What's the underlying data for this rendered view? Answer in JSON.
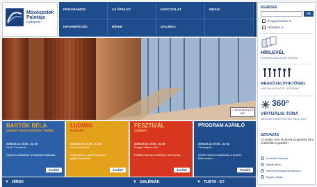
{
  "logo": {
    "line1": "Művészetek",
    "line2": "Palotája",
    "line3": "budapest"
  },
  "nav": [
    {
      "label": "PROGRAMOK"
    },
    {
      "label": "AZ ÉPÜLET"
    },
    {
      "label": "KAPCSOLAT"
    },
    {
      "label": "MÉDIA"
    },
    {
      "label": "INFORMÁCIÓK"
    },
    {
      "label": "HÍREK"
    },
    {
      "label": "GALÉRIA"
    },
    {
      "label": ""
    }
  ],
  "search": {
    "title": "KERESÉS",
    "placeholder": "",
    "ok_label": "OK",
    "checkbox1": "Programokban is",
    "checkbox2": "Hírekben is"
  },
  "sidebar": {
    "newsletter_title": "HÍRLEVÉL",
    "newsletter_sub": "FELIRATKOZÁS A HÍRLEVÉLRE",
    "access_title": "MEGKÖZELÍTHETŐSÉG",
    "access_sub": "HOGYAN JUTHAT EL HOZZÁNK?",
    "tour_title_a": "360°",
    "tour_title_b": "VIRTUÁLIS TÚRA",
    "tour_sub": "JÁRJA BE A MŰVÉSZETEK PALOTÁJÁT"
  },
  "poll": {
    "title": "SZAVAZÁS",
    "question": "Az épület mely részének programjai iránt érdeklődik leginkább?",
    "options": [
      "Fesztivál Színház",
      "Bartók Béla",
      "Nemzeti Hangversenyterem",
      "Egyéb helyek"
    ]
  },
  "hero": {
    "zoom_label": "NÖVESZTHETŐ KÉP"
  },
  "cards": [
    {
      "title": "BARTÓK BÉLA",
      "subtitle": "NEMZETI HANGVERSENYTEREM",
      "date": "2006.09.16 19:00 - 22:30",
      "event": "Verdi: Trovatore",
      "text": "Opera a palotában ünnepélyes előadás...",
      "more": "Tovább",
      "color": "#2b5fa8"
    },
    {
      "title": "LUDWIG",
      "subtitle": "MÚZEUM",
      "date": "2006.09.09 10:00 - 22:30",
      "event": "Fesztivál nézeti",
      "text": "Válogatás a Ludwig Múzeum gyűjteményéből...",
      "more": "Tovább",
      "color": "#e4a21a"
    },
    {
      "title": "FESZTIVÁL",
      "subtitle": "SZÍNHÁZ",
      "date": "2006.09.16 19:00 - 22:00",
      "event": "Magyar Állami népi...",
      "text": "Példák népi tánc estekből, ünnepi bál...",
      "more": "Tovább",
      "color": "#d8361f"
    },
    {
      "title": "PROGRAM AJÁNLÓ",
      "subtitle": "",
      "date": "2006.09.21 20:00 - 22:02",
      "event": "Táncképek",
      "text": "Zenés, táncos varázsolás a Bohém Éttermeben...",
      "more": "Tovább",
      "color": "#1f4d8c"
    }
  ],
  "bottom": [
    {
      "label": "HÍREK"
    },
    {
      "label": "GALÉRIÁK"
    },
    {
      "label": "TUDTA - E?"
    }
  ]
}
